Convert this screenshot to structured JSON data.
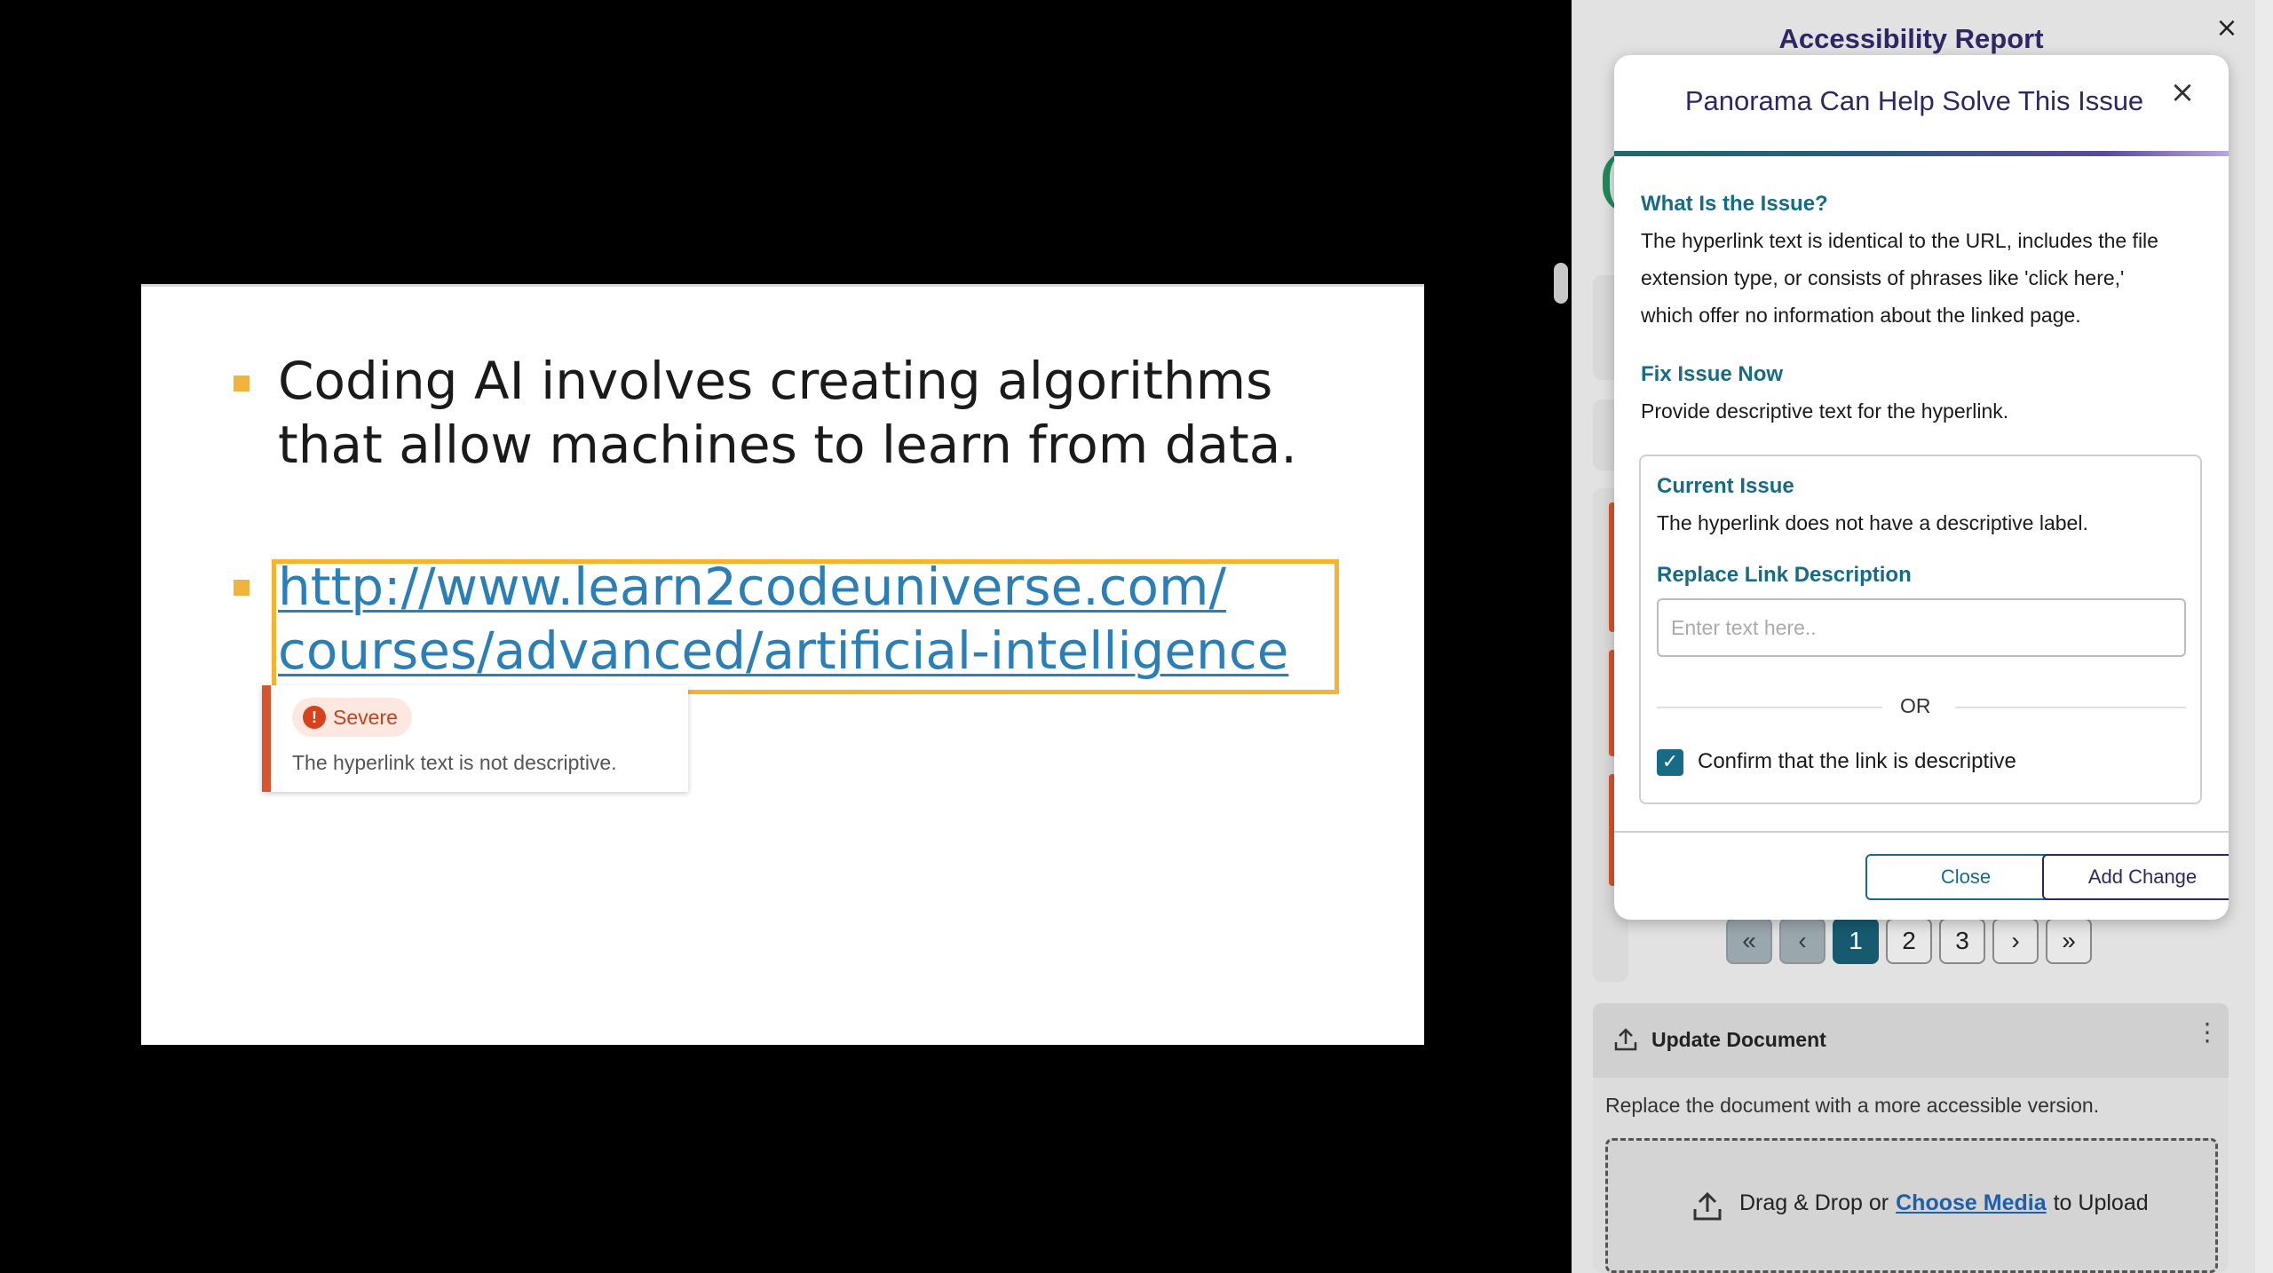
{
  "slide": {
    "bullet1_line1": "Coding AI involves creating algorithms",
    "bullet1_line2": "that allow machines to learn from data.",
    "link_line1": "http://www.learn2codeuniverse.com/",
    "link_line2": "courses/advanced/artificial-intelligence"
  },
  "issue_tip": {
    "badge_icon": "!",
    "severity": "Severe",
    "message": "The hyperlink text is not descriptive."
  },
  "panel": {
    "title": "Accessibility Report",
    "close_glyph": "×",
    "pagination": {
      "first": "«",
      "prev": "‹",
      "pages": [
        "1",
        "2",
        "3"
      ],
      "current": "1",
      "next": "›",
      "last": "»"
    },
    "update": {
      "title": "Update Document",
      "menu_glyph": "⋮",
      "description": "Replace the document with a more accessible version.",
      "drop_prefix": "Drag & Drop or",
      "drop_link": "Choose Media",
      "drop_suffix": "to Upload"
    }
  },
  "modal": {
    "title": "Panorama Can Help Solve This Issue",
    "close_glyph": "×",
    "what_heading": "What Is the Issue?",
    "what_line1": "The hyperlink text is identical to the URL, includes the file",
    "what_line2": "extension type, or consists of phrases like 'click here,'",
    "what_line3": "which offer no information about the linked page.",
    "fix_heading": "Fix Issue Now",
    "fix_body": "Provide descriptive text for the hyperlink.",
    "current_heading": "Current Issue",
    "current_body": "The hyperlink does not have a descriptive label.",
    "replace_heading": "Replace Link Description",
    "input_placeholder": "Enter text here..",
    "input_value": "",
    "or_text": "OR",
    "checkbox_checked": true,
    "checkbox_glyph": "✓",
    "checkbox_label": "Confirm that the link is descriptive",
    "close_button": "Close",
    "add_button": "Add Change"
  },
  "colors": {
    "accent_teal": "#176b86",
    "severe_red": "#d9532c",
    "highlight_yellow": "#f5b330",
    "title_purple": "#2d2766",
    "link_blue": "#2a7fb8"
  }
}
